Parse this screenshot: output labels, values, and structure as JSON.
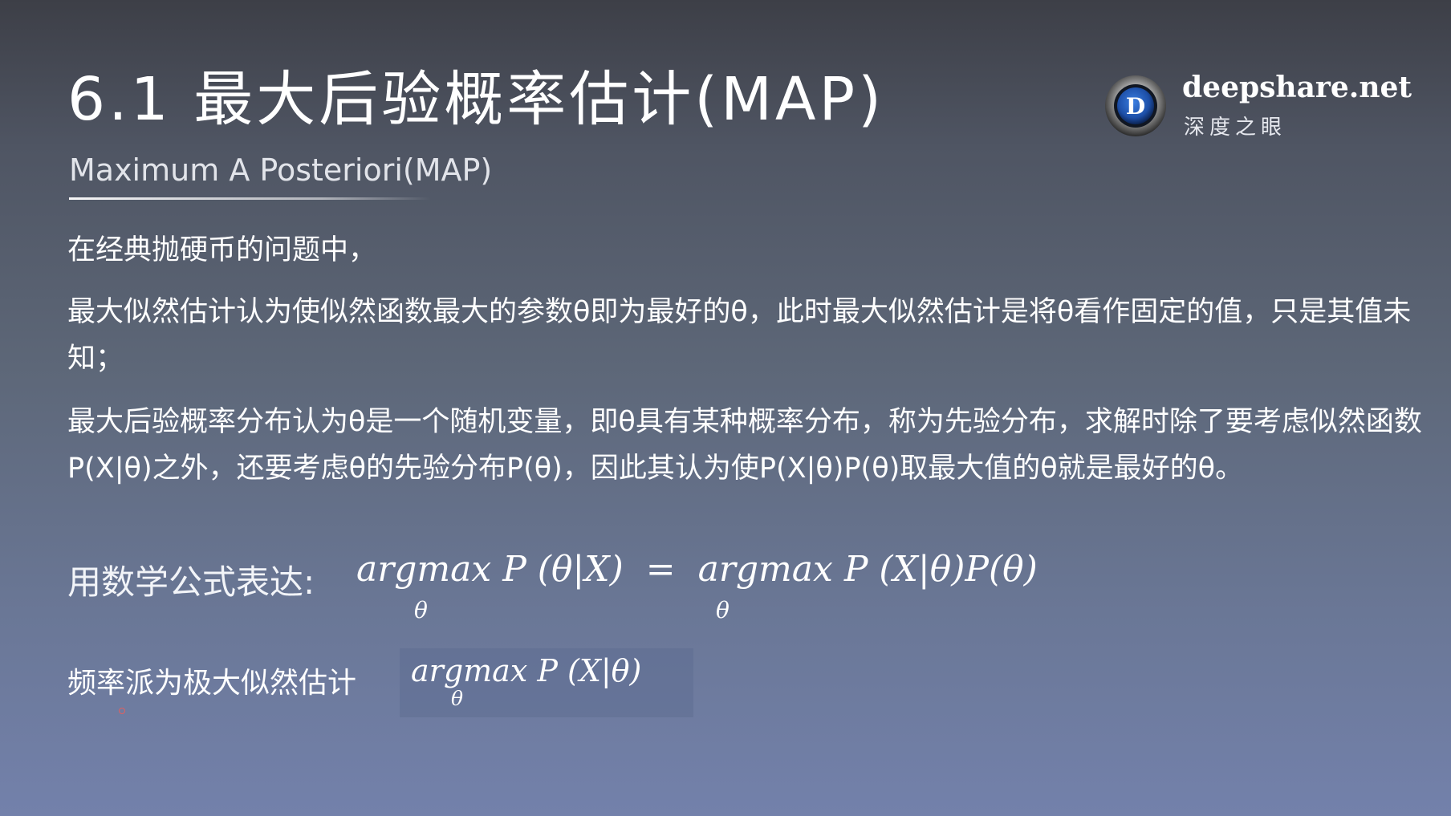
{
  "title": "6.1 最大后验概率估计(MAP)",
  "subtitle": "Maximum A Posteriori(MAP)",
  "logo": {
    "name": "deepshare.net",
    "cn": "深度之眼",
    "mark_letter": "D",
    "icon": "eye-logo-icon"
  },
  "paragraphs": [
    "在经典抛硬币的问题中，",
    "最大似然估计认为使似然函数最大的参数θ即为最好的θ，此时最大似然估计是将θ看作固定的值，只是其值未知；",
    "最大后验概率分布认为θ是一个随机变量，即θ具有某种概率分布，称为先验分布，求解时除了要考虑似然函数P(X|θ)之外，还要考虑θ的先验分布P(θ)，因此其认为使P(X|θ)P(θ)取最大值的θ就是最好的θ。"
  ],
  "formula": {
    "label": "用数学公式表达:",
    "left": "argmax P (θ|X)",
    "equals": "=",
    "right": "argmax P (X|θ)P(θ)",
    "sub": "θ"
  },
  "frequentist": {
    "label": "频率派为极大似然估计",
    "formula": "argmax P (X|θ)",
    "sub": "θ"
  },
  "colors": {
    "text": "#ffffff",
    "logo_blue": "#1d4fa8"
  }
}
